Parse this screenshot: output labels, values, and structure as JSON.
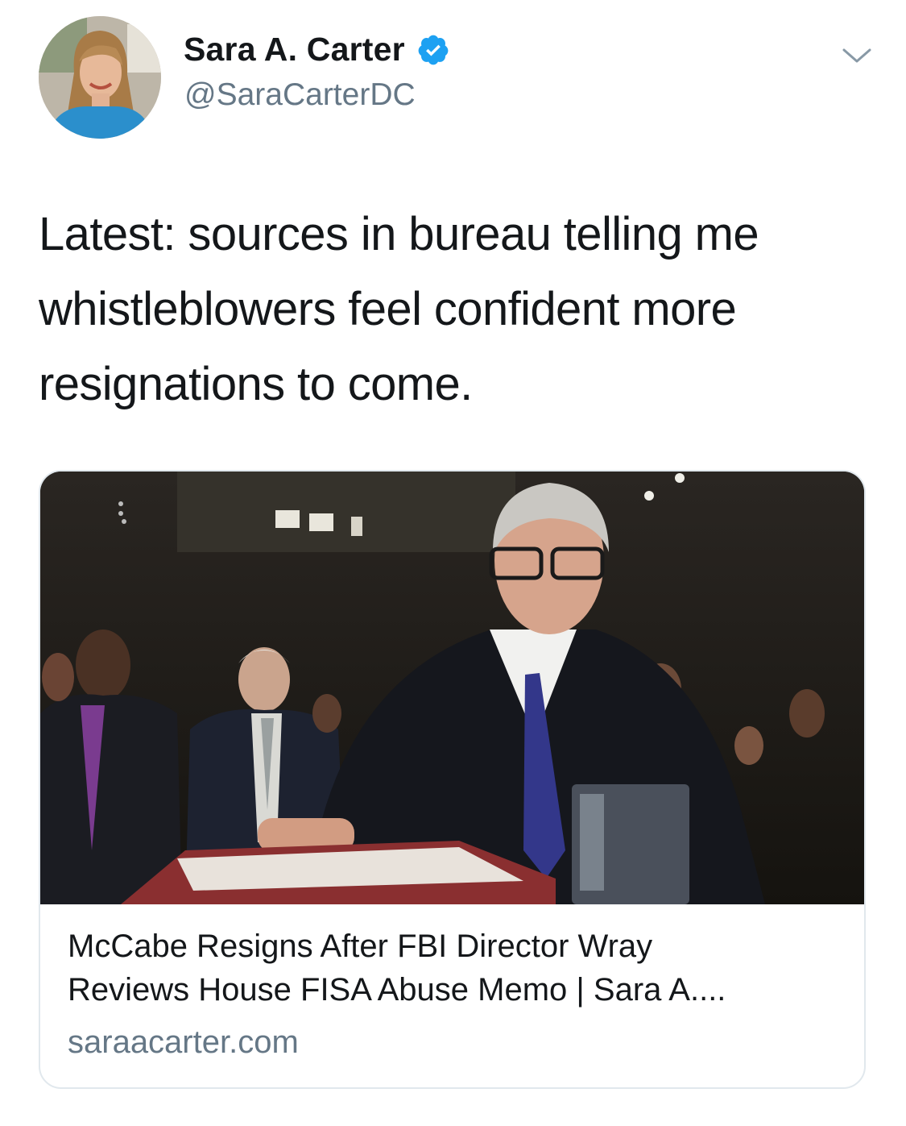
{
  "author": {
    "display_name": "Sara A. Carter",
    "handle": "@SaraCarterDC",
    "verified": true
  },
  "tweet": {
    "text": "Latest: sources in bureau telling me whistleblowers feel confident more resignations to come."
  },
  "card": {
    "title_line1": "McCabe Resigns After FBI Director Wray",
    "title_line2": "Reviews House FISA Abuse Memo | Sara A....",
    "domain": "saraacarter.com"
  },
  "colors": {
    "text_primary": "#14171a",
    "text_secondary": "#657786",
    "verified_blue": "#1da1f2",
    "card_border": "#e1e8ed"
  },
  "icons": {
    "verified": "verified-badge-icon",
    "menu": "chevron-down-icon"
  }
}
